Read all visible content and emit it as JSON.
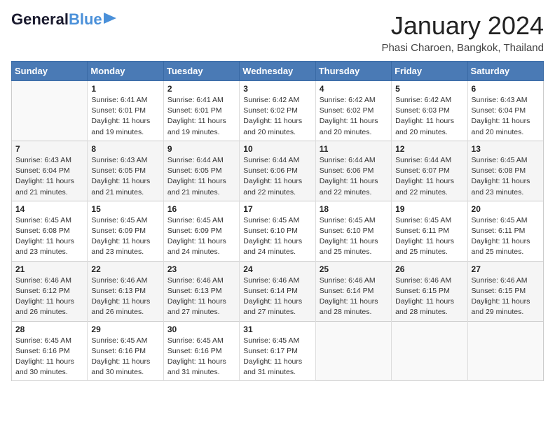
{
  "header": {
    "logo_line1": "General",
    "logo_line2": "Blue",
    "month": "January 2024",
    "location": "Phasi Charoen, Bangkok, Thailand"
  },
  "days_of_week": [
    "Sunday",
    "Monday",
    "Tuesday",
    "Wednesday",
    "Thursday",
    "Friday",
    "Saturday"
  ],
  "weeks": [
    [
      {
        "day": "",
        "content": ""
      },
      {
        "day": "1",
        "content": "Sunrise: 6:41 AM\nSunset: 6:01 PM\nDaylight: 11 hours\nand 19 minutes."
      },
      {
        "day": "2",
        "content": "Sunrise: 6:41 AM\nSunset: 6:01 PM\nDaylight: 11 hours\nand 19 minutes."
      },
      {
        "day": "3",
        "content": "Sunrise: 6:42 AM\nSunset: 6:02 PM\nDaylight: 11 hours\nand 20 minutes."
      },
      {
        "day": "4",
        "content": "Sunrise: 6:42 AM\nSunset: 6:02 PM\nDaylight: 11 hours\nand 20 minutes."
      },
      {
        "day": "5",
        "content": "Sunrise: 6:42 AM\nSunset: 6:03 PM\nDaylight: 11 hours\nand 20 minutes."
      },
      {
        "day": "6",
        "content": "Sunrise: 6:43 AM\nSunset: 6:04 PM\nDaylight: 11 hours\nand 20 minutes."
      }
    ],
    [
      {
        "day": "7",
        "content": "Sunrise: 6:43 AM\nSunset: 6:04 PM\nDaylight: 11 hours\nand 21 minutes."
      },
      {
        "day": "8",
        "content": "Sunrise: 6:43 AM\nSunset: 6:05 PM\nDaylight: 11 hours\nand 21 minutes."
      },
      {
        "day": "9",
        "content": "Sunrise: 6:44 AM\nSunset: 6:05 PM\nDaylight: 11 hours\nand 21 minutes."
      },
      {
        "day": "10",
        "content": "Sunrise: 6:44 AM\nSunset: 6:06 PM\nDaylight: 11 hours\nand 22 minutes."
      },
      {
        "day": "11",
        "content": "Sunrise: 6:44 AM\nSunset: 6:06 PM\nDaylight: 11 hours\nand 22 minutes."
      },
      {
        "day": "12",
        "content": "Sunrise: 6:44 AM\nSunset: 6:07 PM\nDaylight: 11 hours\nand 22 minutes."
      },
      {
        "day": "13",
        "content": "Sunrise: 6:45 AM\nSunset: 6:08 PM\nDaylight: 11 hours\nand 23 minutes."
      }
    ],
    [
      {
        "day": "14",
        "content": "Sunrise: 6:45 AM\nSunset: 6:08 PM\nDaylight: 11 hours\nand 23 minutes."
      },
      {
        "day": "15",
        "content": "Sunrise: 6:45 AM\nSunset: 6:09 PM\nDaylight: 11 hours\nand 23 minutes."
      },
      {
        "day": "16",
        "content": "Sunrise: 6:45 AM\nSunset: 6:09 PM\nDaylight: 11 hours\nand 24 minutes."
      },
      {
        "day": "17",
        "content": "Sunrise: 6:45 AM\nSunset: 6:10 PM\nDaylight: 11 hours\nand 24 minutes."
      },
      {
        "day": "18",
        "content": "Sunrise: 6:45 AM\nSunset: 6:10 PM\nDaylight: 11 hours\nand 25 minutes."
      },
      {
        "day": "19",
        "content": "Sunrise: 6:45 AM\nSunset: 6:11 PM\nDaylight: 11 hours\nand 25 minutes."
      },
      {
        "day": "20",
        "content": "Sunrise: 6:45 AM\nSunset: 6:11 PM\nDaylight: 11 hours\nand 25 minutes."
      }
    ],
    [
      {
        "day": "21",
        "content": "Sunrise: 6:46 AM\nSunset: 6:12 PM\nDaylight: 11 hours\nand 26 minutes."
      },
      {
        "day": "22",
        "content": "Sunrise: 6:46 AM\nSunset: 6:13 PM\nDaylight: 11 hours\nand 26 minutes."
      },
      {
        "day": "23",
        "content": "Sunrise: 6:46 AM\nSunset: 6:13 PM\nDaylight: 11 hours\nand 27 minutes."
      },
      {
        "day": "24",
        "content": "Sunrise: 6:46 AM\nSunset: 6:14 PM\nDaylight: 11 hours\nand 27 minutes."
      },
      {
        "day": "25",
        "content": "Sunrise: 6:46 AM\nSunset: 6:14 PM\nDaylight: 11 hours\nand 28 minutes."
      },
      {
        "day": "26",
        "content": "Sunrise: 6:46 AM\nSunset: 6:15 PM\nDaylight: 11 hours\nand 28 minutes."
      },
      {
        "day": "27",
        "content": "Sunrise: 6:46 AM\nSunset: 6:15 PM\nDaylight: 11 hours\nand 29 minutes."
      }
    ],
    [
      {
        "day": "28",
        "content": "Sunrise: 6:45 AM\nSunset: 6:16 PM\nDaylight: 11 hours\nand 30 minutes."
      },
      {
        "day": "29",
        "content": "Sunrise: 6:45 AM\nSunset: 6:16 PM\nDaylight: 11 hours\nand 30 minutes."
      },
      {
        "day": "30",
        "content": "Sunrise: 6:45 AM\nSunset: 6:16 PM\nDaylight: 11 hours\nand 31 minutes."
      },
      {
        "day": "31",
        "content": "Sunrise: 6:45 AM\nSunset: 6:17 PM\nDaylight: 11 hours\nand 31 minutes."
      },
      {
        "day": "",
        "content": ""
      },
      {
        "day": "",
        "content": ""
      },
      {
        "day": "",
        "content": ""
      }
    ]
  ]
}
